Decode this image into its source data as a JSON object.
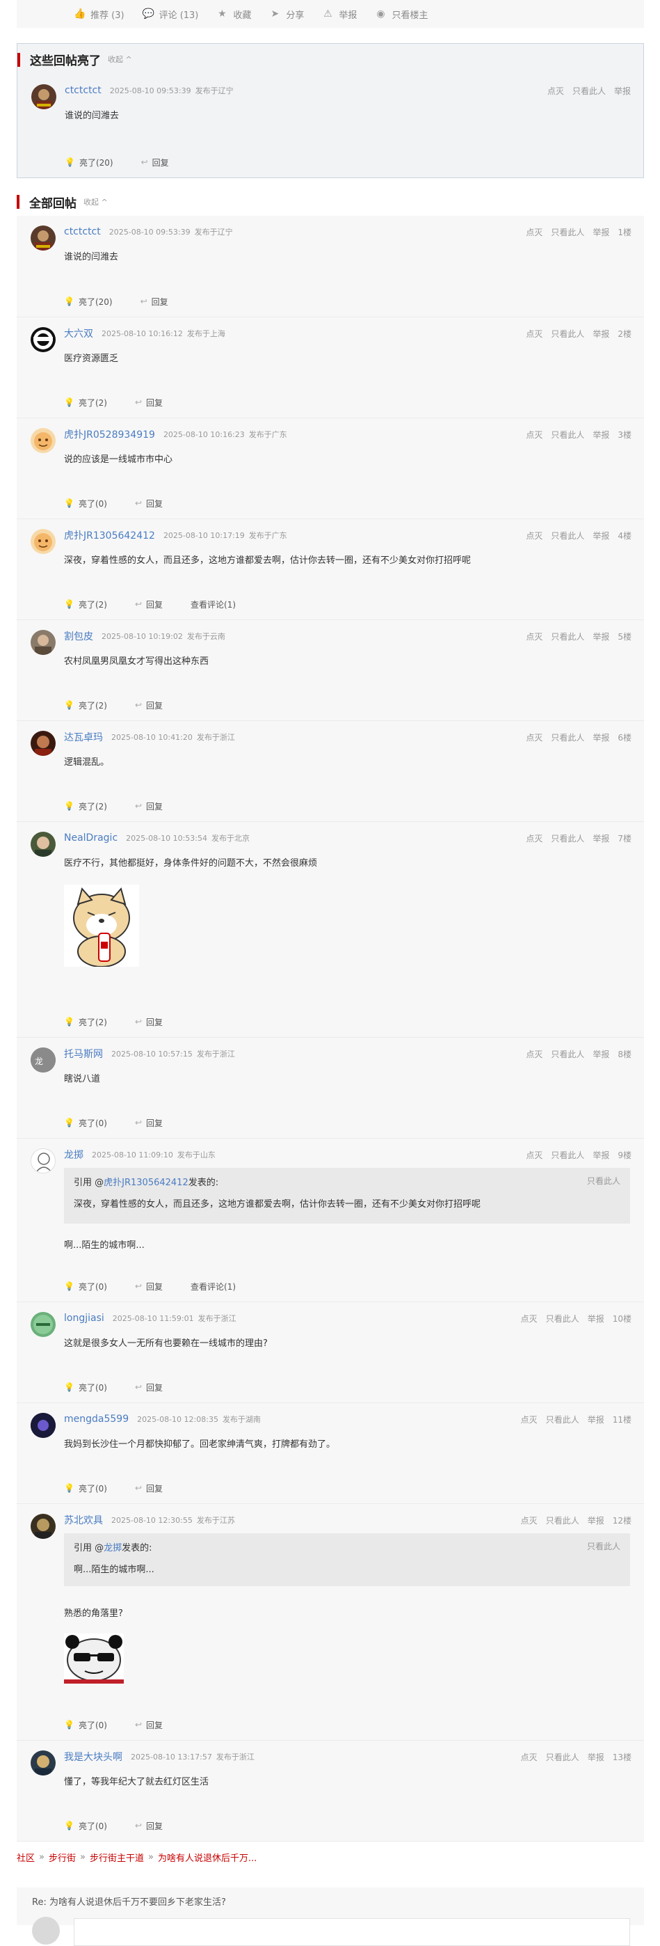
{
  "action_bar": {
    "recommend": "推荐 (3)",
    "comment": "评论 (13)",
    "favorite": "收藏",
    "share": "分享",
    "report": "举报",
    "only_op": "只看楼主"
  },
  "highlight": {
    "title": "这些回帖亮了",
    "collapse": "收起"
  },
  "all": {
    "title": "全部回帖",
    "collapse": "收起"
  },
  "labels": {
    "dislike": "点灭",
    "only_this": "只看此人",
    "report": "举报",
    "reply": "回复",
    "quote_prefix": "引用 @",
    "quote_suffix": " 发表的:",
    "view_comments": "查看评论(1)"
  },
  "highlight_post": {
    "user": "ctctctct",
    "time": "2025-08-10 09:53:39",
    "location": "发布于辽宁",
    "content": "谁说的闫潍去",
    "light": "亮了(20)"
  },
  "posts": [
    {
      "user": "ctctctct",
      "time": "2025-08-10 09:53:39",
      "location": "发布于辽宁",
      "floor": "1楼",
      "content": "谁说的闫潍去",
      "light": "亮了(20)"
    },
    {
      "user": "大六双",
      "time": "2025-08-10 10:16:12",
      "location": "发布于上海",
      "floor": "2楼",
      "content": "医疗资源匮乏",
      "light": "亮了(2)"
    },
    {
      "user": "虎扑JR0528934919",
      "time": "2025-08-10 10:16:23",
      "location": "发布于广东",
      "floor": "3楼",
      "content": "说的应该是一线城市市中心",
      "light": "亮了(0)"
    },
    {
      "user": "虎扑JR1305642412",
      "time": "2025-08-10 10:17:19",
      "location": "发布于广东",
      "floor": "4楼",
      "content": "深夜，穿着性感的女人，而且还多，这地方谁都爱去啊，估计你去转一圈，还有不少美女对你打招呼呢",
      "light": "亮了(2)",
      "comments": "查看评论(1)"
    },
    {
      "user": "割包皮",
      "time": "2025-08-10 10:19:02",
      "location": "发布于云南",
      "floor": "5楼",
      "content": "农村凤凰男凤凰女才写得出这种东西",
      "light": "亮了(2)"
    },
    {
      "user": "达瓦卓玛",
      "time": "2025-08-10 10:41:20",
      "location": "发布于浙江",
      "floor": "6楼",
      "content": "逻辑混乱。",
      "light": "亮了(2)"
    },
    {
      "user": "NealDragic",
      "time": "2025-08-10 10:53:54",
      "location": "发布于北京",
      "floor": "7楼",
      "content": "医疗不行，其他都挺好，身体条件好的问题不大，不然会很麻烦",
      "light": "亮了(2)"
    },
    {
      "user": "托马斯网",
      "time": "2025-08-10 10:57:15",
      "location": "发布于浙江",
      "floor": "8楼",
      "content": "瞎说八道",
      "light": "亮了(0)"
    },
    {
      "user": "龙掷",
      "time": "2025-08-10 11:09:10",
      "location": "发布于山东",
      "floor": "9楼",
      "quote_user": "虎扑JR1305642412",
      "quote_text": "深夜，穿着性感的女人，而且还多，这地方谁都爱去啊，估计你去转一圈，还有不少美女对你打招呼呢",
      "content": "啊...陌生的城市啊...",
      "light": "亮了(0)",
      "comments": "查看评论(1)"
    },
    {
      "user": "longjiasi",
      "time": "2025-08-10 11:59:01",
      "location": "发布于浙江",
      "floor": "10楼",
      "content": "这就是很多女人一无所有也要赖在一线城市的理由?",
      "light": "亮了(0)"
    },
    {
      "user": "mengda5599",
      "time": "2025-08-10 12:08:35",
      "location": "发布于湖南",
      "floor": "11楼",
      "content": "我妈到长沙住一个月都快抑郁了。回老家绅清气爽，打牌都有劲了。",
      "light": "亮了(0)"
    },
    {
      "user": "苏北欢具",
      "time": "2025-08-10 12:30:55",
      "location": "发布于江苏",
      "floor": "12楼",
      "quote_user": "龙掷",
      "quote_text": "啊...陌生的城市啊...",
      "content": "熟悉的角落里?",
      "light": "亮了(0)"
    },
    {
      "user": "我是大块头啊",
      "time": "2025-08-10 13:17:57",
      "location": "发布于浙江",
      "floor": "13楼",
      "content": "懂了，等我年纪大了就去红灯区生活",
      "light": "亮了(0)"
    }
  ],
  "breadcrumb": [
    "社区",
    "步行街",
    "步行街主干道",
    "为啥有人说退休后千万..."
  ],
  "reply_title": "Re: 为啥有人说退休后千万不要回乡下老家生活?"
}
